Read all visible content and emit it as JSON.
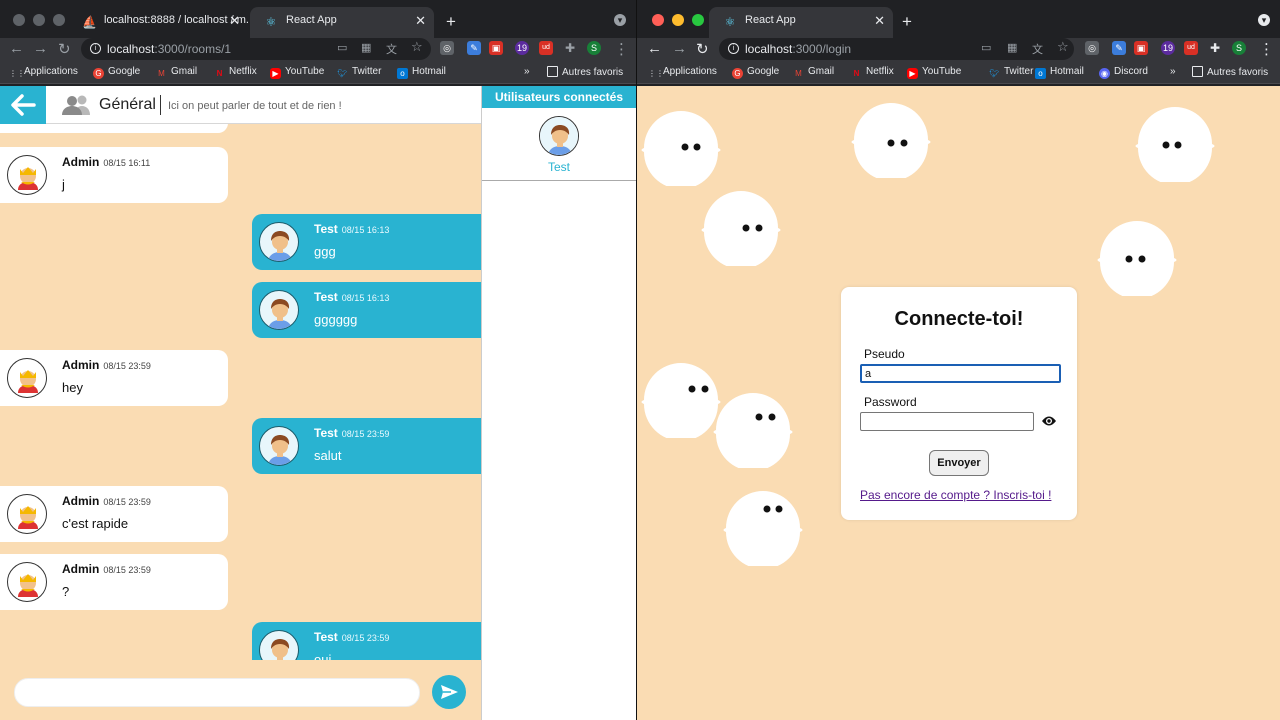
{
  "left_window": {
    "tabs": [
      {
        "title": "localhost:8888 / localhost / m..."
      },
      {
        "title": "React App"
      }
    ],
    "url_host": "localhost",
    "url_path": ":3000/rooms/1",
    "extension_badge": "19",
    "profile_initial": "S",
    "bookmarks": [
      "Applications",
      "Google",
      "Gmail",
      "Netflix",
      "YouTube",
      "Twitter",
      "Hotmail"
    ],
    "bookmarks_more": "»",
    "other_bookmarks": "Autres favoris",
    "chat": {
      "channel_title": "Général",
      "channel_desc": "Ici on peut parler de tout et de rien !",
      "users_header": "Utilisateurs connectés",
      "connected_users": [
        "Test"
      ],
      "messages": [
        {
          "author": "Admin",
          "time": "08/15 16:11",
          "text": "j",
          "side": "in"
        },
        {
          "author": "Test",
          "time": "08/15 16:13",
          "text": "ggg",
          "side": "out"
        },
        {
          "author": "Test",
          "time": "08/15 16:13",
          "text": "gggggg",
          "side": "out"
        },
        {
          "author": "Admin",
          "time": "08/15 23:59",
          "text": "hey",
          "side": "in"
        },
        {
          "author": "Test",
          "time": "08/15 23:59",
          "text": "salut",
          "side": "out"
        },
        {
          "author": "Admin",
          "time": "08/15 23:59",
          "text": "c'est rapide",
          "side": "in"
        },
        {
          "author": "Admin",
          "time": "08/15 23:59",
          "text": "?",
          "side": "in"
        },
        {
          "author": "Test",
          "time": "08/15 23:59",
          "text": "oui",
          "side": "out"
        }
      ],
      "compose_value": ""
    }
  },
  "right_window": {
    "tabs": [
      {
        "title": "React App"
      }
    ],
    "url_host": "localhost",
    "url_path": ":3000/login",
    "extension_badge": "19",
    "profile_initial": "S",
    "bookmarks": [
      "Applications",
      "Google",
      "Gmail",
      "Netflix",
      "YouTube",
      "Twitter",
      "Hotmail",
      "Discord"
    ],
    "bookmarks_more": "»",
    "other_bookmarks": "Autres favoris",
    "login": {
      "title": "Connecte-toi!",
      "pseudo_label": "Pseudo",
      "pseudo_value": "a",
      "password_label": "Password",
      "password_value": "",
      "submit_label": "Envoyer",
      "signup_link": "Pas encore de compte ? Inscris-toi !"
    }
  },
  "colors": {
    "accent": "#29b3d1",
    "background": "#fadcb3",
    "chrome_dark": "#202124",
    "chrome_toolbar": "#35363a"
  }
}
